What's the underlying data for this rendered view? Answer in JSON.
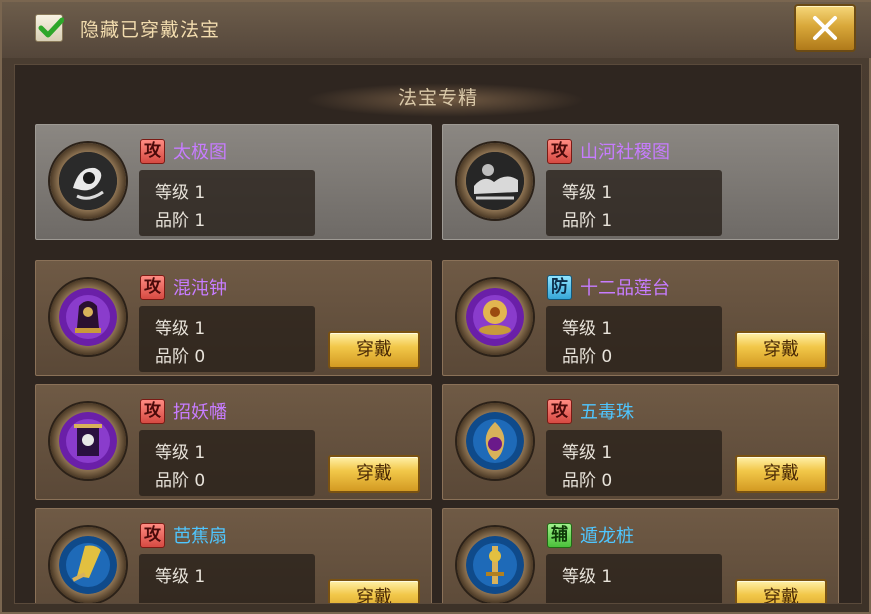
{
  "header": {
    "hide_equipped_label": "隐藏已穿戴法宝",
    "hide_equipped_checked": true,
    "close_symbol": "✕"
  },
  "panel": {
    "title": "法宝专精"
  },
  "labels": {
    "level": "等级",
    "grade": "品阶",
    "wear": "穿戴"
  },
  "items": [
    {
      "type": "攻",
      "type_kind": "attack",
      "name": "太极图",
      "name_color": "purple",
      "level": "1",
      "grade": "1",
      "state": "equipped",
      "icon": "taiji-map-icon"
    },
    {
      "type": "攻",
      "type_kind": "attack",
      "name": "山河社稷图",
      "name_color": "purple",
      "level": "1",
      "grade": "1",
      "state": "equipped",
      "icon": "landscape-scroll-icon"
    },
    {
      "type": "攻",
      "type_kind": "attack",
      "name": "混沌钟",
      "name_color": "purple",
      "level": "1",
      "grade": "0",
      "state": "available",
      "icon": "chaos-bell-icon"
    },
    {
      "type": "防",
      "type_kind": "defense",
      "name": "十二品莲台",
      "name_color": "purple",
      "level": "1",
      "grade": "0",
      "state": "available",
      "icon": "lotus-platform-icon"
    },
    {
      "type": "攻",
      "type_kind": "attack",
      "name": "招妖幡",
      "name_color": "purple",
      "level": "1",
      "grade": "0",
      "state": "available",
      "icon": "demon-banner-icon"
    },
    {
      "type": "攻",
      "type_kind": "attack",
      "name": "五毒珠",
      "name_color": "blue",
      "level": "1",
      "grade": "0",
      "state": "available",
      "icon": "poison-pearl-icon"
    },
    {
      "type": "攻",
      "type_kind": "attack",
      "name": "芭蕉扇",
      "name_color": "blue",
      "level": "1",
      "grade": "",
      "state": "available",
      "icon": "banana-fan-icon"
    },
    {
      "type": "辅",
      "type_kind": "support",
      "name": "遁龙桩",
      "name_color": "blue",
      "level": "1",
      "grade": "",
      "state": "available",
      "icon": "dragon-pillar-icon"
    }
  ],
  "colors": {
    "attack_tag": "#d64a42",
    "defense_tag": "#36a7d8",
    "support_tag": "#4bc13a",
    "name_purple": "#c77cff",
    "name_blue": "#4fc6ff",
    "button_gold": "#f2c84a"
  }
}
